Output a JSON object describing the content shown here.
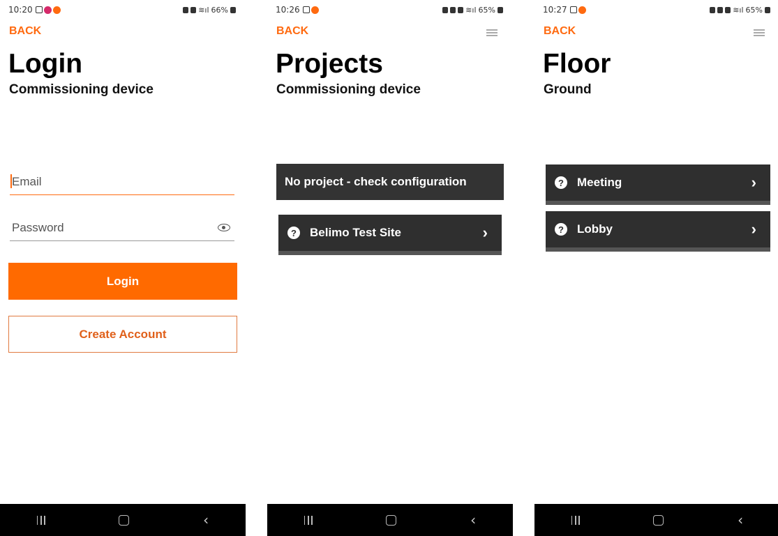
{
  "colors": {
    "accent": "#ff6a00",
    "card": "#2f2f2f",
    "navbar": "#000000"
  },
  "screens": [
    {
      "status": {
        "time": "10:20",
        "battery": "66%"
      },
      "back_label": "BACK",
      "title": "Login",
      "subtitle": "Commissioning device",
      "email_placeholder": "Email",
      "password_placeholder": "Password",
      "login_label": "Login",
      "create_account_label": "Create Account"
    },
    {
      "status": {
        "time": "10:26",
        "battery": "65%"
      },
      "back_label": "BACK",
      "title": "Projects",
      "subtitle": "Commissioning device",
      "banner": "No project - check configuration",
      "items": [
        {
          "label": "Belimo Test Site",
          "icon": "question-icon"
        }
      ]
    },
    {
      "status": {
        "time": "10:27",
        "battery": "65%"
      },
      "back_label": "BACK",
      "title": "Floor",
      "subtitle": "Ground",
      "items": [
        {
          "label": "Meeting",
          "icon": "question-icon"
        },
        {
          "label": "Lobby",
          "icon": "question-icon"
        }
      ]
    }
  ],
  "navbar": {
    "back_glyph": "‹",
    "icons": [
      "recent-apps-icon",
      "home-icon",
      "back-icon"
    ]
  }
}
